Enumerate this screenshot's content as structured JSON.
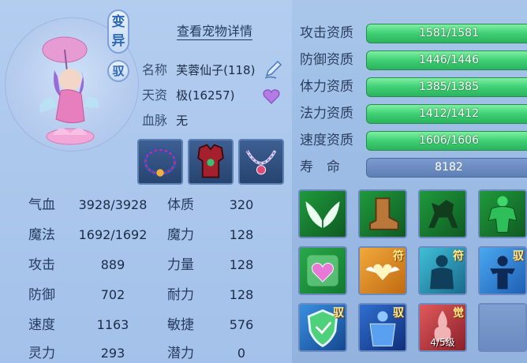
{
  "header": {
    "variant_badge": "变\n异",
    "tame_badge": "驭",
    "details_link": "查看宠物详情"
  },
  "pet_info": {
    "name_label": "名称",
    "name_value": "芙蓉仙子(118)",
    "aptitude_label": "天资",
    "aptitude_value": "极(16257)",
    "bloodline_label": "血脉",
    "bloodline_value": "无"
  },
  "stats": [
    {
      "label": "气血",
      "value": "3928/3928",
      "label2": "体质",
      "value2": "320"
    },
    {
      "label": "魔法",
      "value": "1692/1692",
      "label2": "魔力",
      "value2": "128"
    },
    {
      "label": "攻击",
      "value": "889",
      "label2": "力量",
      "value2": "128"
    },
    {
      "label": "防御",
      "value": "702",
      "label2": "耐力",
      "value2": "128"
    },
    {
      "label": "速度",
      "value": "1163",
      "label2": "敏捷",
      "value2": "576"
    },
    {
      "label": "灵力",
      "value": "293",
      "label2": "潜力",
      "value2": "0"
    }
  ],
  "aptitudes": [
    {
      "label": "攻击资质",
      "value": "1581/1581"
    },
    {
      "label": "防御资质",
      "value": "1446/1446"
    },
    {
      "label": "体力资质",
      "value": "1385/1385"
    },
    {
      "label": "法力资质",
      "value": "1412/1412"
    },
    {
      "label": "速度资质",
      "value": "1606/1606"
    }
  ],
  "lifespan": {
    "label": "寿　命",
    "value": "8182"
  },
  "skills": [
    {
      "icon": "wings-icon",
      "tag": ""
    },
    {
      "icon": "boot-icon",
      "tag": ""
    },
    {
      "icon": "horse-icon",
      "tag": ""
    },
    {
      "icon": "muscle-icon",
      "tag": ""
    },
    {
      "icon": "heart-icon",
      "tag": ""
    },
    {
      "icon": "wing-heart-icon",
      "tag": "符"
    },
    {
      "icon": "spirit-icon",
      "tag": "符"
    },
    {
      "icon": "warrior-icon",
      "tag": "驭"
    },
    {
      "icon": "shield-icon",
      "tag": "驭"
    },
    {
      "icon": "armor-icon",
      "tag": "驭"
    },
    {
      "icon": "awaken-icon",
      "tag": "觉",
      "level": "4/5级"
    },
    {
      "icon": "",
      "tag": ""
    }
  ],
  "colors": {
    "bar_green": "#3fcf74",
    "bar_blue": "#5e7fb5",
    "text_dark": "#1d2f4d"
  }
}
